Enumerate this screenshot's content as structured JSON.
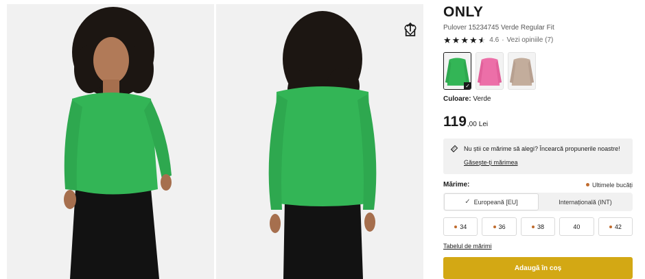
{
  "gallery": {
    "images": [
      {
        "alt_icon": "model-front-photo"
      },
      {
        "alt_icon": "model-back-photo"
      }
    ],
    "wishlist_icon": "heart-icon",
    "share_icon": "share-icon"
  },
  "product": {
    "brand": "ONLY",
    "subtitle": "Pulover 15234745 Verde Regular Fit",
    "rating": "4.6",
    "rating_value": 4.6,
    "separator": "·",
    "reviews_link": "Vezi opiniile (7)"
  },
  "colors": {
    "swatches": [
      {
        "name": "Verde",
        "hex": "#33b556",
        "selected": true
      },
      {
        "name": "Roz",
        "hex": "#ec6fa8",
        "selected": false
      },
      {
        "name": "Bej",
        "hex": "#c3ad9c",
        "selected": false
      }
    ],
    "label": "Culoare:",
    "value": "Verde"
  },
  "price": {
    "integer": "119",
    "decimals": ",00",
    "currency": "Lei"
  },
  "size_advice": {
    "text": "Nu știi ce mărime să alegi? Încearcă propunerile noastre!",
    "link": "Găsește-ți mărimea"
  },
  "sizes": {
    "title": "Mărime:",
    "last_items": "Ultimele bucăți",
    "systems": [
      "Europeană [EU]",
      "Internațională (INT)"
    ],
    "options": [
      {
        "label": "34",
        "low_stock": true
      },
      {
        "label": "36",
        "low_stock": true
      },
      {
        "label": "38",
        "low_stock": true
      },
      {
        "label": "40",
        "low_stock": false
      },
      {
        "label": "42",
        "low_stock": true
      }
    ],
    "table_link": "Tabelul de mărimi"
  },
  "cart": {
    "add_label": "Adaugă în coș"
  },
  "colors_theme": {
    "accent": "#d3a814",
    "low_stock_dot": "#c06b2d",
    "sweater": "#33b556"
  }
}
